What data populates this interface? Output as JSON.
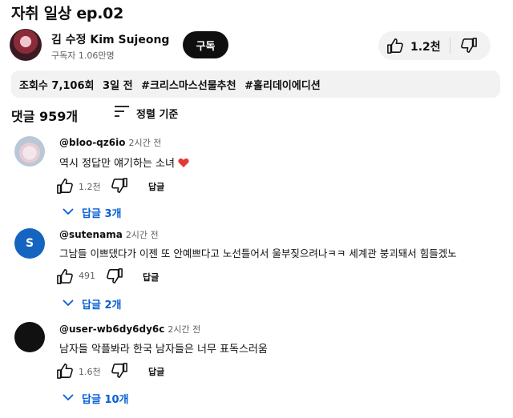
{
  "video": {
    "title": "자취 일상 ep.02",
    "channel_name": "김 수정 Kim Sujeong",
    "subscribers": "구독자 1.06만명",
    "subscribe_label": "구독",
    "likes": "1.2천",
    "views": "조회수 7,106회",
    "age": "3일 전",
    "hashtags": [
      "#크리스마스선물추천",
      "#홀리데이에디션"
    ]
  },
  "comments_header": {
    "count_label": "댓글 959개",
    "sort_label": "정렬 기준"
  },
  "comments": [
    {
      "author": "@bloo-qz6io",
      "time": "2시간 전",
      "text": "역시 정답만 얘기하는 소녀",
      "emoji": "❤️",
      "likes": "1.2천",
      "reply_label": "답글",
      "replies_label": "답글 3개"
    },
    {
      "avatar_letter": "S",
      "author": "@sutenama",
      "time": "2시간 전",
      "text": "그남들 이쁘댔다가 이젠 또 안예쁘다고 노선틀어서 울부짖으려나ㅋㅋ 세계관 붕괴돼서 힘들겠노",
      "likes": "491",
      "reply_label": "답글",
      "replies_label": "답글 2개"
    },
    {
      "author": "@user-wb6dy6dy6c",
      "time": "2시간 전",
      "text": "남자들 악플봐라 한국 남자들은 너무 표독스러움",
      "likes": "1.6천",
      "reply_label": "답글",
      "replies_label": "답글 10개"
    }
  ],
  "colors": {
    "accent_blue": "#065fd4",
    "button_dark": "#0f0f0f",
    "pill_bg": "#f2f2f2",
    "meta_gray": "#606060",
    "heart_red": "#e53935"
  },
  "icons": {
    "like": "thumb-up-icon",
    "dislike": "thumb-down-icon",
    "sort": "sort-lines-icon",
    "expand": "chevron-down-icon"
  }
}
